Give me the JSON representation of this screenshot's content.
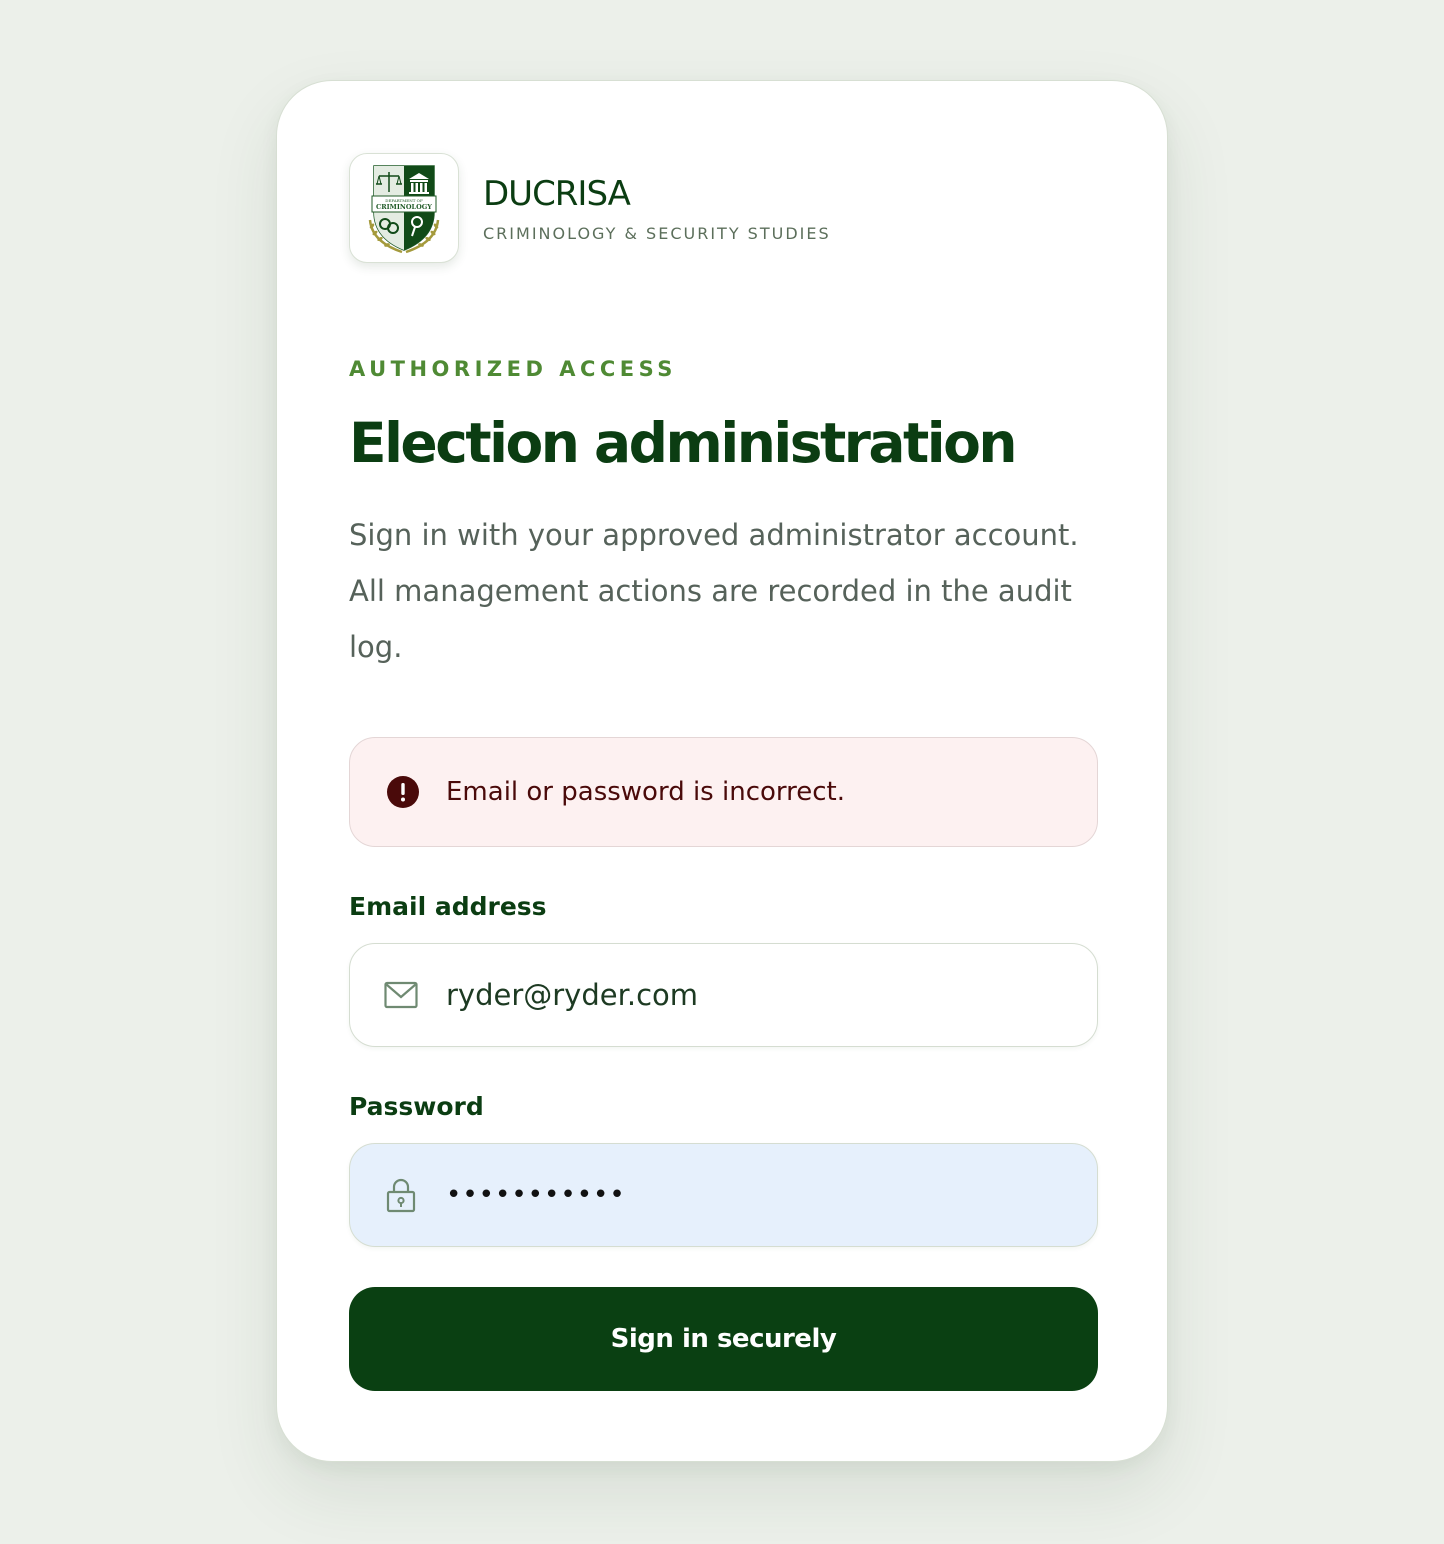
{
  "brand": {
    "name": "DUCRISA",
    "subtitle": "CRIMINOLOGY & SECURITY STUDIES",
    "logo_text_top": "DEPARTMENT OF",
    "logo_text_main": "CRIMINOLOGY"
  },
  "page": {
    "eyebrow": "AUTHORIZED ACCESS",
    "title": "Election administration",
    "description": "Sign in with your approved administrator account. All management actions are recorded in the audit log."
  },
  "alert": {
    "icon": "alert-circle-icon",
    "message": "Email or password is incorrect."
  },
  "form": {
    "email": {
      "label": "Email address",
      "icon": "mail-icon",
      "value": "ryder@ryder.com"
    },
    "password": {
      "label": "Password",
      "icon": "lock-icon",
      "masked_value": "•••••••••••"
    },
    "submit_label": "Sign in securely"
  },
  "colors": {
    "background": "#ecf0ea",
    "primary": "#0a4012",
    "accent": "#4f8a34",
    "alert_bg": "#fdf1f1",
    "password_bg": "#e6f0fc"
  }
}
